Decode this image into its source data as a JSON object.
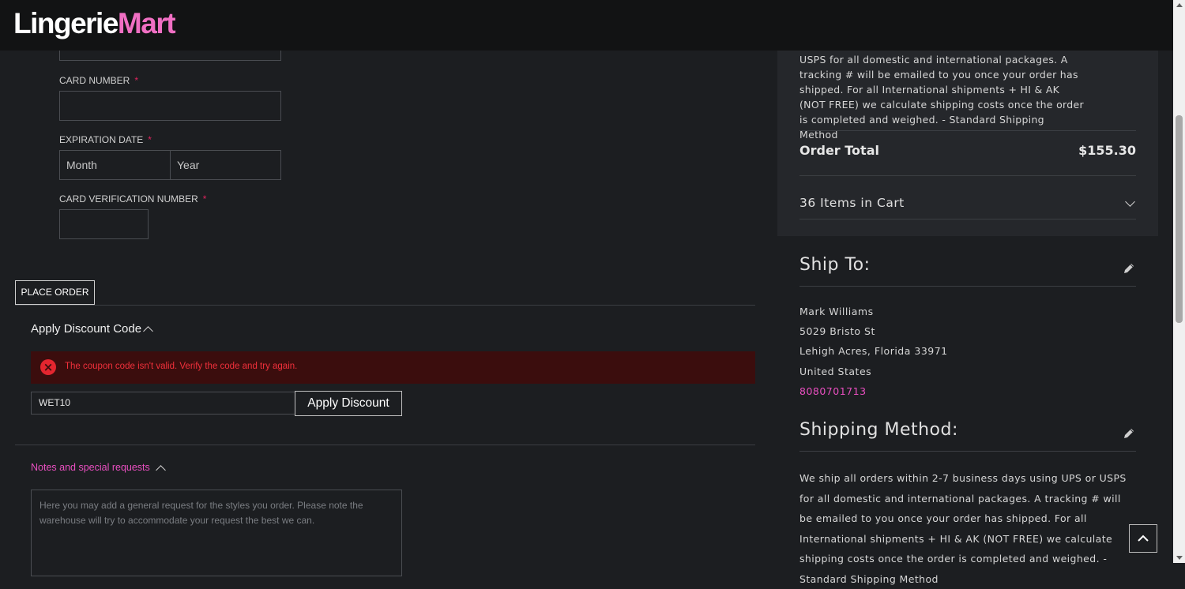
{
  "brand": {
    "part1": "Lingerie",
    "part2": "Mart"
  },
  "payment": {
    "card_number_label": "CARD NUMBER",
    "expiration_label": "EXPIRATION DATE",
    "month_placeholder": "Month",
    "year_placeholder": "Year",
    "cvv_label": "CARD VERIFICATION NUMBER",
    "required_mark": "*",
    "place_order": "PLACE ORDER"
  },
  "discount": {
    "title": "Apply Discount Code",
    "error": "The coupon code isn't valid. Verify the code and try again.",
    "code_value": "WET10",
    "apply_label": "Apply Discount"
  },
  "notes": {
    "title": "Notes and special requests",
    "placeholder": "Here you may add a general request for the styles you order. Please note the warehouse will try to accommodate your request the best we can."
  },
  "summary": {
    "shipping_note": "USPS for all domestic and international packages. A tracking # will be emailed to you once your order has shipped. For all International shipments + HI & AK (NOT FREE) we calculate shipping costs once the order is completed and weighed. - Standard Shipping Method",
    "order_total_label": "Order Total",
    "order_total_value": "$155.30",
    "items_in_cart": "36 Items in Cart"
  },
  "ship_to": {
    "title": "Ship To:",
    "name": "Mark Williams",
    "street": "5029 Bristo St",
    "city_line": "Lehigh Acres, Florida 33971",
    "country": "United States",
    "phone": "8080701713"
  },
  "shipping_method": {
    "title": "Shipping Method:",
    "text": "We ship all orders within 2-7 business days using UPS or USPS for all domestic and international packages. A tracking # will be emailed to you once your order has shipped. For all International shipments + HI & AK (NOT FREE) we calculate shipping costs once the order is completed and weighed. - Standard Shipping Method"
  },
  "icons": {
    "error": "×",
    "edit": "pencil-icon",
    "back_to_top": "chevron-up-icon"
  },
  "colors": {
    "accent": "#e94fc0",
    "error": "#f1303b",
    "background": "#1c1e21"
  }
}
